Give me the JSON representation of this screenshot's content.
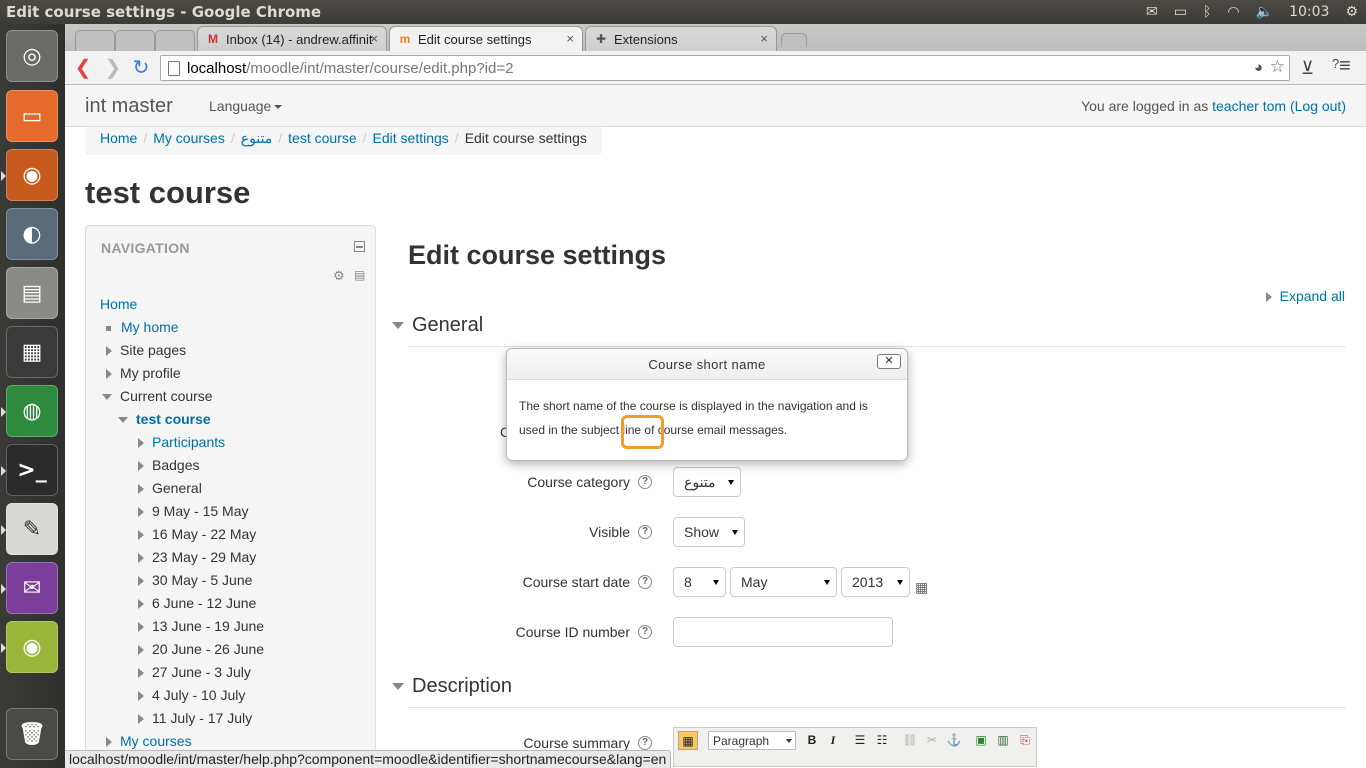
{
  "os": {
    "window_title": "Edit course settings - Google Chrome",
    "clock": "10:03",
    "tray_icons": [
      "mail-icon",
      "battery-icon",
      "bluetooth-icon",
      "wifi-icon",
      "volume-icon"
    ]
  },
  "launcher": [
    "ubuntu-logo-icon",
    "files-icon",
    "firefox-icon",
    "disk-utility-icon",
    "drive-icon",
    "workspace-switcher-icon",
    "chrome-icon",
    "terminal-icon",
    "text-editor-icon",
    "pidgin-icon",
    "speaker-icon",
    "trash-icon"
  ],
  "tabs": [
    {
      "label": "Inbox (14) - andrew.affinit",
      "icon": "gmail-icon"
    },
    {
      "label": "Edit course settings",
      "icon": "moodle-icon"
    },
    {
      "label": "Extensions",
      "icon": "puzzle-icon"
    }
  ],
  "address": {
    "host": "localhost",
    "path": "/moodle/int/master/course/edit.php?id=2"
  },
  "navbar": {
    "brand": "int master",
    "language": "Language",
    "login_prefix": "You are logged in as ",
    "user": "teacher tom",
    "logout": "(Log out)"
  },
  "breadcrumb": [
    "Home",
    "My courses",
    "متنوع",
    "test course",
    "Edit settings",
    "Edit course settings"
  ],
  "course_title": "test course",
  "navigation": {
    "header": "NAVIGATION",
    "items": [
      {
        "label": "Home",
        "link": true
      },
      {
        "label": "My home",
        "link": true
      },
      {
        "label": "Site pages",
        "link": false
      },
      {
        "label": "My profile",
        "link": false
      },
      {
        "label": "Current course",
        "link": false
      },
      {
        "label": "test course",
        "link": true
      },
      {
        "label": "Participants",
        "link": true
      },
      {
        "label": "Badges",
        "link": false
      },
      {
        "label": "General",
        "link": false
      },
      {
        "label": "9 May - 15 May",
        "link": false
      },
      {
        "label": "16 May - 22 May",
        "link": false
      },
      {
        "label": "23 May - 29 May",
        "link": false
      },
      {
        "label": "30 May - 5 June",
        "link": false
      },
      {
        "label": "6 June - 12 June",
        "link": false
      },
      {
        "label": "13 June - 19 June",
        "link": false
      },
      {
        "label": "20 June - 26 June",
        "link": false
      },
      {
        "label": "27 June - 3 July",
        "link": false
      },
      {
        "label": "4 July - 10 July",
        "link": false
      },
      {
        "label": "11 July - 17 July",
        "link": false
      },
      {
        "label": "My courses",
        "link": true
      }
    ]
  },
  "main": {
    "heading": "Edit course settings",
    "expand_all": "Expand all",
    "section_general": "General",
    "section_description": "Description",
    "fields": {
      "category_label": "Course category",
      "category_value": "متنوع",
      "visible_label": "Visible",
      "visible_value": "Show",
      "start_label": "Course start date",
      "start_day": "8",
      "start_month": "May",
      "start_year": "2013",
      "idnumber_label": "Course ID number",
      "idnumber_value": "",
      "summary_label": "Course summary",
      "summary_format": "Paragraph",
      "partial_label": "C"
    }
  },
  "popup": {
    "title": "Course short name",
    "close": "✕",
    "body": "The short name of the course is displayed in the navigation and is used in the subject line of course email messages."
  },
  "status_url": "localhost/moodle/int/master/help.php?component=moodle&identifier=shortnamecourse&lang=en"
}
